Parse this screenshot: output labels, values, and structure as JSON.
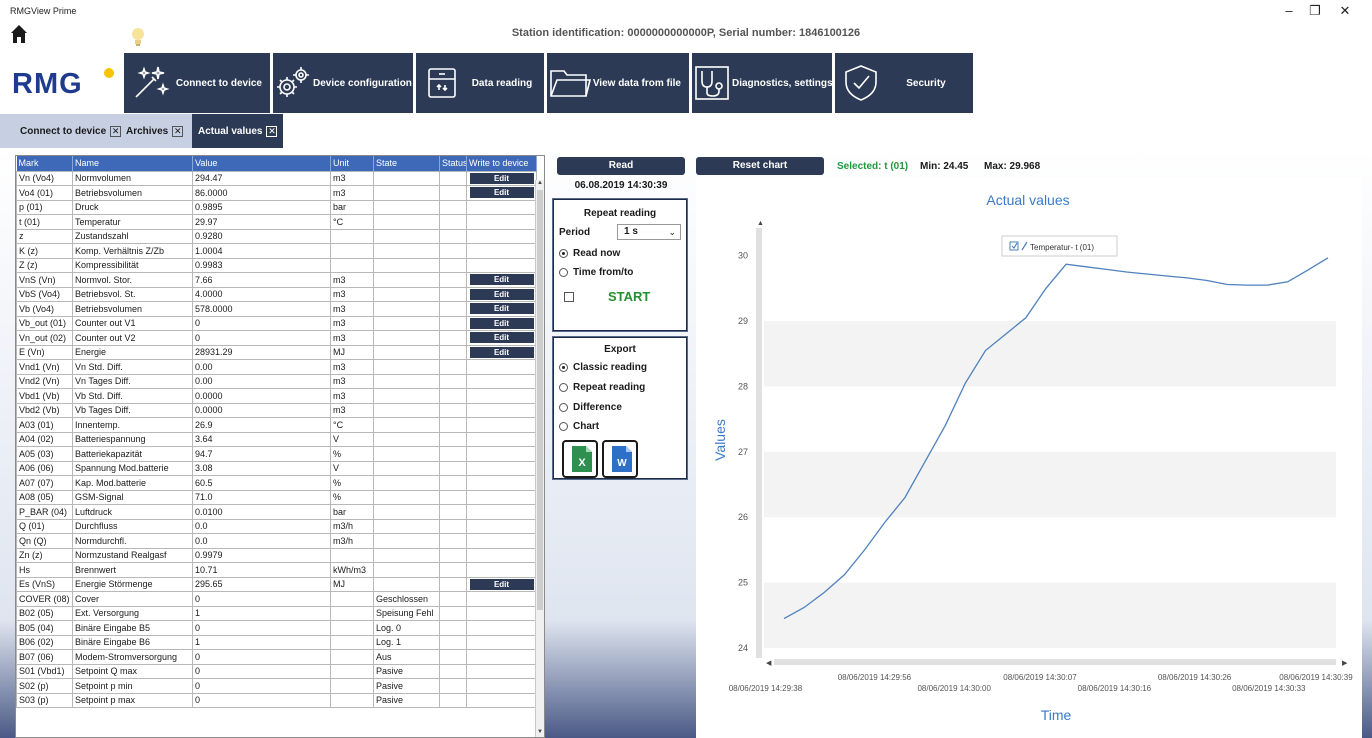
{
  "window": {
    "app_title": "RMGView Prime",
    "minimize": "–",
    "restore": "❐",
    "close": "✕"
  },
  "header": {
    "station_info": "Station identification: 0000000000000P, Serial number: 1846100126",
    "logo_text": "RMG",
    "logo_dot_color": "#f4c500"
  },
  "ribbon": [
    {
      "label": "Connect to device",
      "icon": "magic-wand-icon"
    },
    {
      "label": "Device configuration",
      "icon": "gears-icon"
    },
    {
      "label": "Data reading",
      "icon": "archive-box-icon"
    },
    {
      "label": "View data from file",
      "icon": "folder-icon"
    },
    {
      "label": "Diagnostics, settings",
      "icon": "stethoscope-icon"
    },
    {
      "label": "Security",
      "icon": "shield-check-icon"
    }
  ],
  "tabs": [
    {
      "label": "Connect to device",
      "active": false
    },
    {
      "label": "Archives",
      "active": false
    },
    {
      "label": "Actual values",
      "active": true
    }
  ],
  "table": {
    "columns": [
      "Mark",
      "Name",
      "Value",
      "Unit",
      "State",
      "Status",
      "Write to device"
    ],
    "edit_label": "Edit",
    "rows": [
      {
        "mark": "Vn (Vo4)",
        "name": "Normvolumen",
        "value": "294.47",
        "unit": "m3",
        "state": "",
        "edit": true
      },
      {
        "mark": "Vo4 (01)",
        "name": "Betriebsvolumen",
        "value": "86.0000",
        "unit": "m3",
        "state": "",
        "edit": true
      },
      {
        "mark": "p (01)",
        "name": "Druck",
        "value": "0.9895",
        "unit": "bar",
        "state": "",
        "edit": false
      },
      {
        "mark": "t (01)",
        "name": "Temperatur",
        "value": "29.97",
        "unit": "°C",
        "state": "",
        "edit": false
      },
      {
        "mark": "z",
        "name": "Zustandszahl",
        "value": "0.9280",
        "unit": "",
        "state": "",
        "edit": false
      },
      {
        "mark": "K (z)",
        "name": "Komp. Verhältnis Z/Zb",
        "value": "1.0004",
        "unit": "",
        "state": "",
        "edit": false
      },
      {
        "mark": "Z (z)",
        "name": "Kompressibilität",
        "value": "0.9983",
        "unit": "",
        "state": "",
        "edit": false
      },
      {
        "mark": "VnS (Vn)",
        "name": "Normvol. Stor.",
        "value": "7.66",
        "unit": "m3",
        "state": "",
        "edit": true
      },
      {
        "mark": "VbS (Vo4)",
        "name": "Betriebsvol. St.",
        "value": "4.0000",
        "unit": "m3",
        "state": "",
        "edit": true
      },
      {
        "mark": "Vb (Vo4)",
        "name": "Betriebsvolumen",
        "value": "578.0000",
        "unit": "m3",
        "state": "",
        "edit": true
      },
      {
        "mark": "Vb_out (01)",
        "name": "Counter out V1",
        "value": "0",
        "unit": "m3",
        "state": "",
        "edit": true
      },
      {
        "mark": "Vn_out (02)",
        "name": "Counter out V2",
        "value": "0",
        "unit": "m3",
        "state": "",
        "edit": true
      },
      {
        "mark": "E (Vn)",
        "name": "Energie",
        "value": "28931.29",
        "unit": "MJ",
        "state": "",
        "edit": true
      },
      {
        "mark": "Vnd1 (Vn)",
        "name": "Vn Std. Diff.",
        "value": "0.00",
        "unit": "m3",
        "state": "",
        "edit": false
      },
      {
        "mark": "Vnd2 (Vn)",
        "name": "Vn Tages Diff.",
        "value": "0.00",
        "unit": "m3",
        "state": "",
        "edit": false
      },
      {
        "mark": "Vbd1 (Vb)",
        "name": "Vb Std. Diff.",
        "value": "0.0000",
        "unit": "m3",
        "state": "",
        "edit": false
      },
      {
        "mark": "Vbd2 (Vb)",
        "name": "Vb Tages Diff.",
        "value": "0.0000",
        "unit": "m3",
        "state": "",
        "edit": false
      },
      {
        "mark": "A03 (01)",
        "name": "Innentemp.",
        "value": "26.9",
        "unit": "°C",
        "state": "",
        "edit": false
      },
      {
        "mark": "A04 (02)",
        "name": "Batteriespannung",
        "value": "3.64",
        "unit": "V",
        "state": "",
        "edit": false
      },
      {
        "mark": "A05 (03)",
        "name": "Batteriekapazität",
        "value": "94.7",
        "unit": "%",
        "state": "",
        "edit": false
      },
      {
        "mark": "A06 (06)",
        "name": "Spannung Mod.batterie",
        "value": "3.08",
        "unit": "V",
        "state": "",
        "edit": false
      },
      {
        "mark": "A07 (07)",
        "name": "Kap. Mod.batterie",
        "value": "60.5",
        "unit": "%",
        "state": "",
        "edit": false
      },
      {
        "mark": "A08 (05)",
        "name": "GSM-Signal",
        "value": "71.0",
        "unit": "%",
        "state": "",
        "edit": false
      },
      {
        "mark": "P_BAR (04)",
        "name": "Luftdruck",
        "value": "0.0100",
        "unit": "bar",
        "state": "",
        "edit": false
      },
      {
        "mark": "Q (01)",
        "name": "Durchfluss",
        "value": "0.0",
        "unit": "m3/h",
        "state": "",
        "edit": false
      },
      {
        "mark": "Qn (Q)",
        "name": "Normdurchfl.",
        "value": "0.0",
        "unit": "m3/h",
        "state": "",
        "edit": false
      },
      {
        "mark": "Zn (z)",
        "name": "Normzustand Realgasf",
        "value": "0.9979",
        "unit": "",
        "state": "",
        "edit": false
      },
      {
        "mark": "Hs",
        "name": "Brennwert",
        "value": "10.71",
        "unit": "kWh/m3",
        "state": "",
        "edit": false
      },
      {
        "mark": "Es (VnS)",
        "name": "Energie Störmenge",
        "value": "295.65",
        "unit": "MJ",
        "state": "",
        "edit": true
      },
      {
        "mark": "COVER (08)",
        "name": "Cover",
        "value": "0",
        "unit": "",
        "state": "Geschlossen",
        "edit": false
      },
      {
        "mark": "B02 (05)",
        "name": "Ext. Versorgung",
        "value": "1",
        "unit": "",
        "state": "Speisung Fehl",
        "edit": false
      },
      {
        "mark": "B05 (04)",
        "name": "Binäre Eingabe B5",
        "value": "0",
        "unit": "",
        "state": "Log. 0",
        "edit": false
      },
      {
        "mark": "B06 (02)",
        "name": "Binäre Eingabe B6",
        "value": "1",
        "unit": "",
        "state": "Log. 1",
        "edit": false
      },
      {
        "mark": "B07 (06)",
        "name": "Modem-Stromversorgung",
        "value": "0",
        "unit": "",
        "state": "Aus",
        "edit": false
      },
      {
        "mark": "S01 (Vbd1)",
        "name": "Setpoint Q max",
        "value": "0",
        "unit": "",
        "state": "Pasive",
        "edit": false
      },
      {
        "mark": "S02 (p)",
        "name": "Setpoint p min",
        "value": "0",
        "unit": "",
        "state": "Pasive",
        "edit": false
      },
      {
        "mark": "S03 (p)",
        "name": "Setpoint p max",
        "value": "0",
        "unit": "",
        "state": "Pasive",
        "edit": false
      }
    ]
  },
  "controls": {
    "read_label": "Read",
    "reset_chart_label": "Reset chart",
    "read_time": "06.08.2019 14:30:39",
    "repeat": {
      "title": "Repeat reading",
      "period_label": "Period",
      "period_value": "1 s",
      "read_now": "Read now",
      "read_now_selected": true,
      "time_from_to": "Time from/to",
      "time_from_to_selected": false,
      "start_label": "START"
    },
    "export": {
      "title": "Export",
      "options": [
        {
          "label": "Classic reading",
          "selected": true
        },
        {
          "label": "Repeat reading",
          "selected": false
        },
        {
          "label": "Difference",
          "selected": false
        },
        {
          "label": "Chart",
          "selected": false
        }
      ],
      "excel_letter": "X",
      "word_letter": "W"
    }
  },
  "chart_info": {
    "selected": "Selected: t (01)",
    "min": "Min: 24.45",
    "max": "Max: 29.968"
  },
  "chart_data": {
    "type": "line",
    "title": "Actual values",
    "xlabel": "Time",
    "ylabel": "Values",
    "ylim": [
      24,
      30.5
    ],
    "yticks": [
      24,
      25,
      26,
      27,
      28,
      29,
      30
    ],
    "grid": true,
    "legend": "top-center",
    "x_ticks_upper": [
      "08/06/2019 14:29:56",
      "08/06/2019 14:30:07",
      "08/06/2019 14:30:26",
      "08/06/2019 14:30:39"
    ],
    "x_ticks_lower": [
      "08/06/2019 14:29:38",
      "08/06/2019 14:30:00",
      "08/06/2019 14:30:16",
      "08/06/2019 14:30:33"
    ],
    "series": [
      {
        "name": "Temperatur- t (01)",
        "color": "#4f81bd",
        "values": [
          24.45,
          24.62,
          24.85,
          25.12,
          25.5,
          25.92,
          26.3,
          26.85,
          27.4,
          28.05,
          28.55,
          28.8,
          29.05,
          29.5,
          29.87,
          29.83,
          29.79,
          29.75,
          29.72,
          29.69,
          29.66,
          29.62,
          29.56,
          29.55,
          29.55,
          29.6,
          29.78,
          29.968
        ]
      }
    ]
  }
}
